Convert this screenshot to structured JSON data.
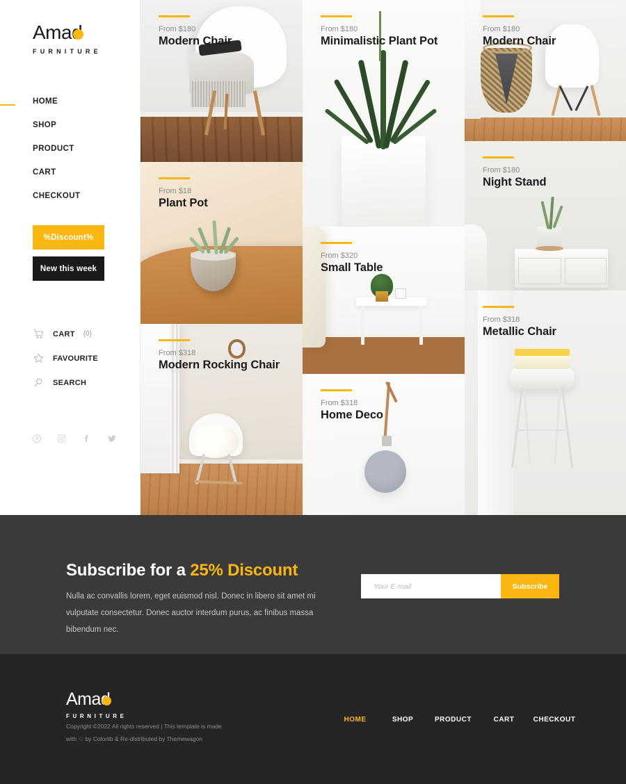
{
  "brand": {
    "name": "Amad",
    "dot": "o",
    "tagline": "FURNITURE"
  },
  "sidebar": {
    "nav": [
      {
        "label": "HOME",
        "active": true
      },
      {
        "label": "SHOP",
        "active": false
      },
      {
        "label": "PRODUCT",
        "active": false
      },
      {
        "label": "CART",
        "active": false
      },
      {
        "label": "CHECKOUT",
        "active": false
      }
    ],
    "buttons": {
      "discount": "%Discount%",
      "new_this_week": "New this week"
    },
    "utilities": [
      {
        "icon": "cart-icon",
        "label": "CART",
        "count": "(0)"
      },
      {
        "icon": "star-icon",
        "label": "FAVOURITE",
        "count": ""
      },
      {
        "icon": "search-icon",
        "label": "SEARCH",
        "count": ""
      }
    ],
    "social": [
      "pinterest-icon",
      "instagram-icon",
      "facebook-icon",
      "twitter-icon"
    ]
  },
  "products": [
    {
      "price": "From $180",
      "title": "Modern Chair"
    },
    {
      "price": "From $18",
      "title": "Plant Pot"
    },
    {
      "price": "From $318",
      "title": "Modern Rocking Chair"
    },
    {
      "price": "From $180",
      "title": "Minimalistic Plant Pot"
    },
    {
      "price": "From $320",
      "title": "Small Table"
    },
    {
      "price": "From $318",
      "title": "Home Deco"
    },
    {
      "price": "From $180",
      "title": "Modern Chair"
    },
    {
      "price": "From $180",
      "title": "Night Stand"
    },
    {
      "price": "From $318",
      "title": "Metallic Chair"
    }
  ],
  "subscribe": {
    "heading_plain": "Subscribe for a ",
    "heading_highlight": "25% Discount",
    "body": "Nulla ac convallis lorem, eget euismod nisl. Donec in libero sit amet mi vulputate consectetur. Donec auctor interdum purus, ac finibus massa bibendum nec.",
    "input_placeholder": "Your E-mail",
    "input_value": "",
    "button_label": "Subscribe"
  },
  "footer": {
    "copyright": "Copyright ©2022 All rights reserved | This template is made with ♡ by Colorlib & Re-distributed by Themewagon",
    "nav": [
      {
        "label": "HOME",
        "active": true
      },
      {
        "label": "SHOP",
        "active": false
      },
      {
        "label": "PRODUCT",
        "active": false
      },
      {
        "label": "CART",
        "active": false
      },
      {
        "label": "CHECKOUT",
        "active": false
      }
    ]
  },
  "colors": {
    "accent": "#fbb710",
    "dark": "#1a1a1a",
    "subscribe_bg": "#3a3a3a",
    "footer_bg": "#252525"
  }
}
